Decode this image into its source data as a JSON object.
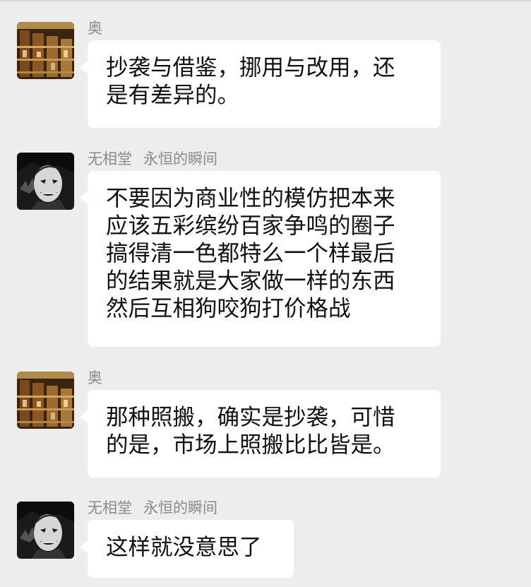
{
  "messages": [
    {
      "sender": "奥",
      "group_nickname": "",
      "avatar": "bookshelf-avatar",
      "lines": [
        "抄袭与借鉴，挪用与改用，还",
        "是有差异的。"
      ]
    },
    {
      "sender": "无相堂",
      "group_nickname": "永恒的瞬间",
      "avatar": "joker-avatar",
      "lines": [
        "不要因为商业性的模仿把本来",
        "应该五彩缤纷百家争鸣的圈子",
        "搞得清一色都特么一个样最后",
        "的结果就是大家做一样的东西",
        "然后互相狗咬狗打价格战"
      ]
    },
    {
      "sender": "奥",
      "group_nickname": "",
      "avatar": "bookshelf-avatar",
      "lines": [
        "那种照搬，确实是抄袭，可惜",
        "的是，市场上照搬比比皆是。"
      ]
    },
    {
      "sender": "无相堂",
      "group_nickname": "永恒的瞬间",
      "avatar": "joker-avatar",
      "lines": [
        "这样就没意思了"
      ]
    }
  ],
  "colors": {
    "background": "#ededed",
    "bubble": "#ffffff",
    "sender_text": "#8a8a8a",
    "message_text": "#111111"
  }
}
